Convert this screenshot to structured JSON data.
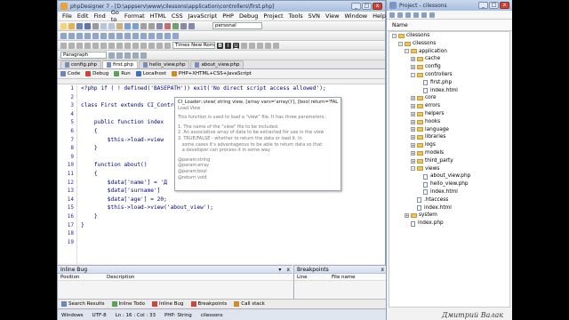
{
  "main": {
    "title": "phpDesigner 7 - [D:\\appserv\\www\\cilessons\\application\\controllers\\first.php]",
    "menu": [
      "File",
      "Edit",
      "Find",
      "Go to",
      "Format",
      "HTML",
      "CSS",
      "JavaScript",
      "PHP",
      "Debug",
      "Project",
      "Tools",
      "SVN",
      "View",
      "Window",
      "Help"
    ],
    "toolbar": {
      "profile": "personal",
      "font": "Times New Rom",
      "style": "Paragraph"
    },
    "file_tabs": [
      "config.php",
      "first.php",
      "hello_view.php",
      "about_view.php"
    ],
    "active_tab": 1,
    "run_buttons": [
      "Code",
      "Debug",
      "Run",
      "Localhost",
      "PHP+XHTML+CSS+JavaScript"
    ],
    "code_lines": [
      "<?php if ( ! defined('BASEPATH')) exit('No direct script access allowed');",
      "",
      "class First extends CI_Controller {",
      "",
      "    public function index",
      "    {",
      "        $this->load->view",
      "    }",
      "",
      "    function about()",
      "    {",
      "        $data['name'] = 'Д",
      "        $data['surname'] ",
      "        $data['age'] = 20;",
      "        $this->load->view('about_view');",
      "    }",
      "}",
      "",
      ""
    ],
    "tooltip": {
      "signature": "CI_Loader::view( string view, [array vars='array()'], [bool return='FALSE'] )",
      "subtitle": "Load View",
      "desc": "This function is used to load a \"view\" file. It has three parameters:",
      "points": [
        "1. The name of the \"view\" file to be included.",
        "2. An associative array of data to be extracted for use in the view",
        "3. TRUE/FALSE - whether to return the data or load it. In",
        "   some cases it's advantageous to be able to return data so that",
        "   a developer can process it in some way."
      ],
      "params": [
        {
          "tag": "@param",
          "type": "string"
        },
        {
          "tag": "@param",
          "type": "array"
        },
        {
          "tag": "@param",
          "type": "bool"
        },
        {
          "tag": "@return",
          "type": "void"
        }
      ]
    },
    "inline_bug": {
      "title": "Inline Bug",
      "col1": "Position",
      "col2": "Description"
    },
    "breakpoints": {
      "title": "Breakpoints",
      "col1": "Line",
      "col2": "File name"
    },
    "bottom_tabs": [
      "Search Results",
      "Inline Todo",
      "Inline Bug",
      "Breakpoints",
      "Call stack"
    ],
    "status": [
      "Windows",
      "UTF-8",
      "Ln : 16 : Col : 33",
      "PHP: String",
      "cilessons"
    ]
  },
  "project": {
    "title": "Project - cilessons",
    "name_header": "Name",
    "tree": [
      {
        "label": "cilessons",
        "level": 0,
        "type": "folder",
        "open": true
      },
      {
        "label": "cilessons",
        "level": 1,
        "type": "folder",
        "open": true
      },
      {
        "label": "application",
        "level": 2,
        "type": "folder",
        "open": true
      },
      {
        "label": "cache",
        "level": 3,
        "type": "folder"
      },
      {
        "label": "config",
        "level": 3,
        "type": "folder"
      },
      {
        "label": "controllers",
        "level": 3,
        "type": "folder",
        "open": true
      },
      {
        "label": "first.php",
        "level": 4,
        "type": "file"
      },
      {
        "label": "index.html",
        "level": 4,
        "type": "file"
      },
      {
        "label": "core",
        "level": 3,
        "type": "folder"
      },
      {
        "label": "errors",
        "level": 3,
        "type": "folder"
      },
      {
        "label": "helpers",
        "level": 3,
        "type": "folder"
      },
      {
        "label": "hooks",
        "level": 3,
        "type": "folder"
      },
      {
        "label": "language",
        "level": 3,
        "type": "folder"
      },
      {
        "label": "libraries",
        "level": 3,
        "type": "folder"
      },
      {
        "label": "logs",
        "level": 3,
        "type": "folder"
      },
      {
        "label": "models",
        "level": 3,
        "type": "folder"
      },
      {
        "label": "third_party",
        "level": 3,
        "type": "folder"
      },
      {
        "label": "views",
        "level": 3,
        "type": "folder",
        "open": true
      },
      {
        "label": "about_view.php",
        "level": 4,
        "type": "file"
      },
      {
        "label": "hello_view.php",
        "level": 4,
        "type": "file"
      },
      {
        "label": "index.html",
        "level": 4,
        "type": "file"
      },
      {
        "label": ".htaccess",
        "level": 3,
        "type": "file"
      },
      {
        "label": "index.html",
        "level": 3,
        "type": "file"
      },
      {
        "label": "system",
        "level": 2,
        "type": "folder"
      },
      {
        "label": "index.php",
        "level": 2,
        "type": "file"
      }
    ]
  },
  "watermark": "Дмитрий Валак"
}
